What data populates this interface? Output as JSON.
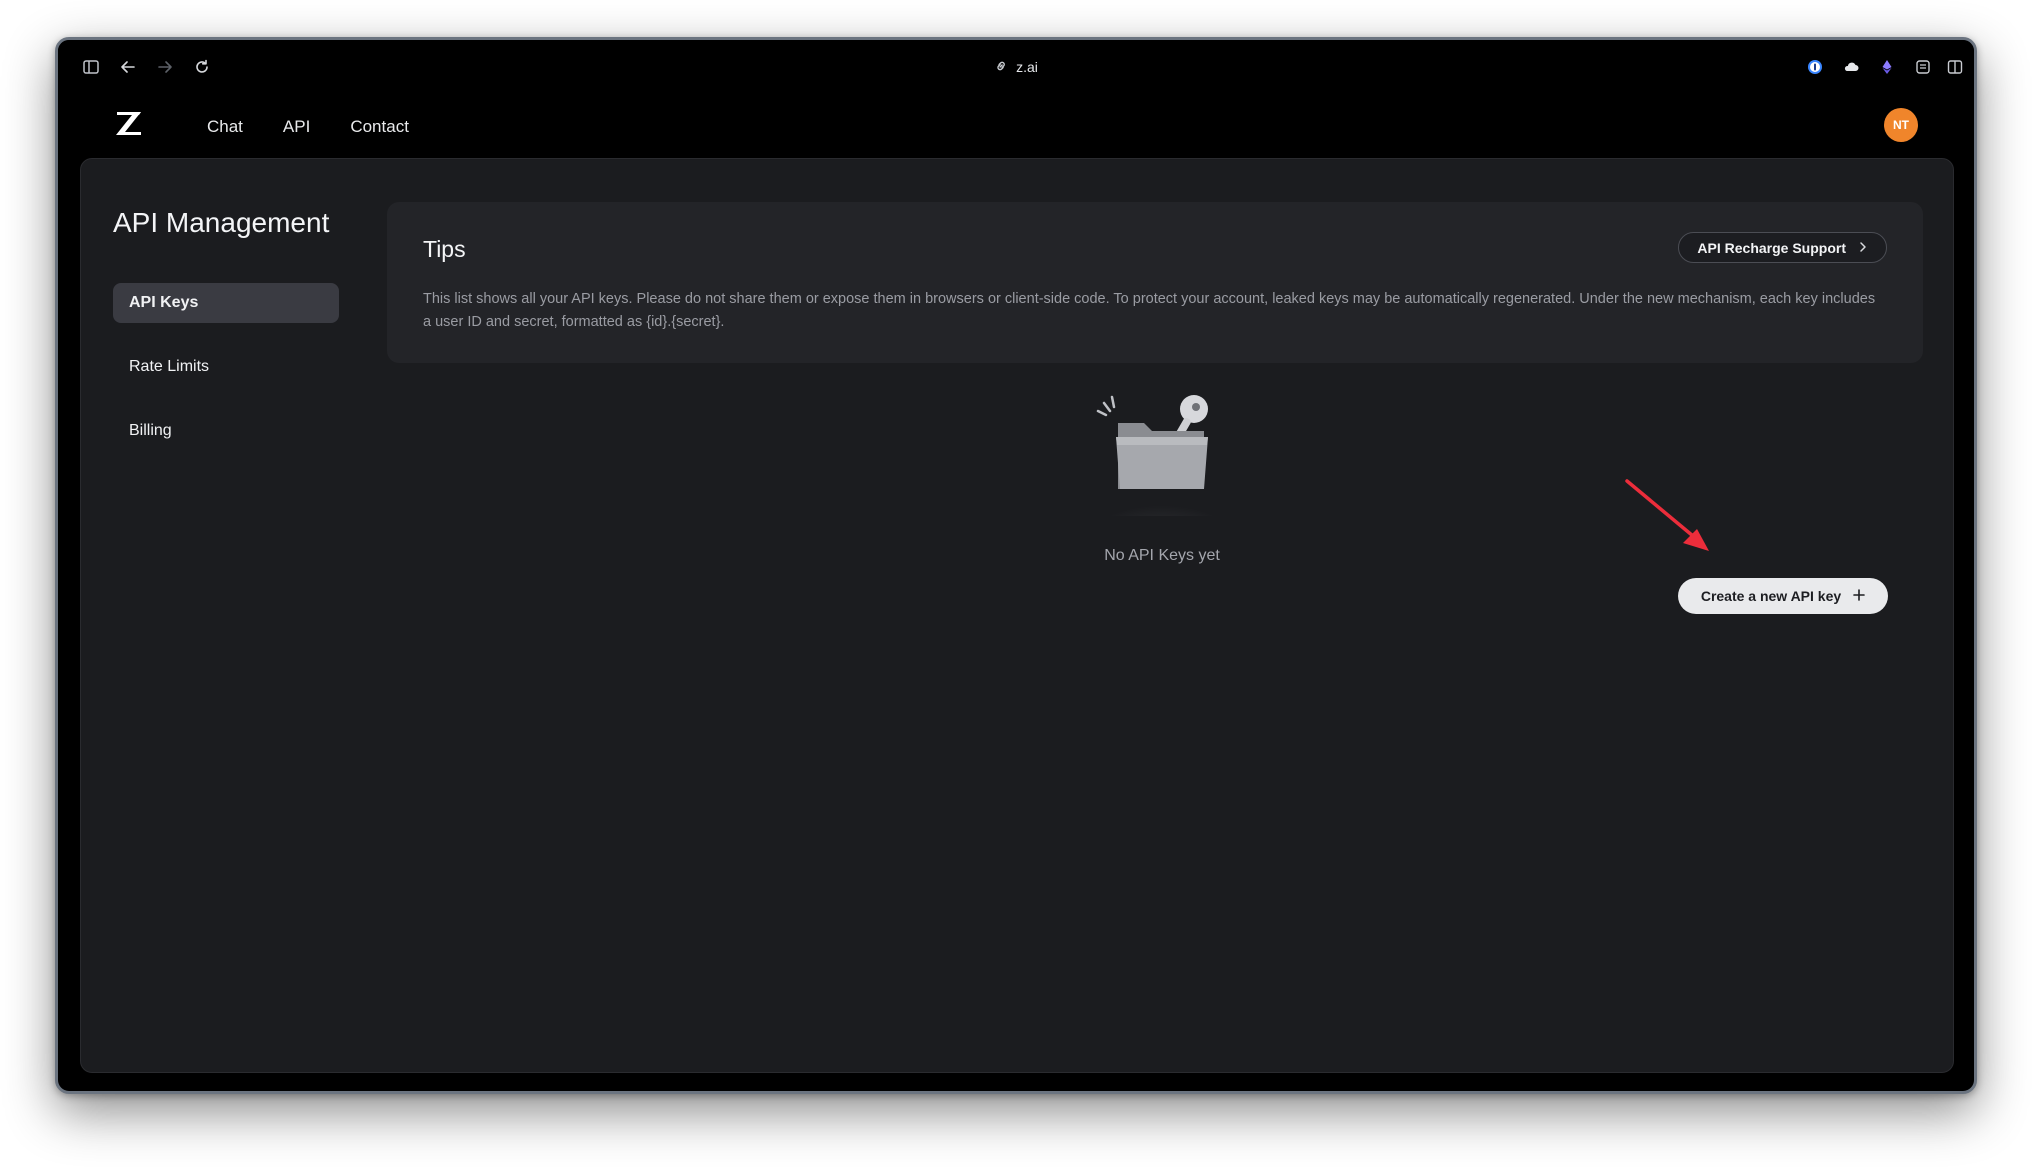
{
  "browser": {
    "url": "z.ai"
  },
  "header": {
    "nav": [
      "Chat",
      "API",
      "Contact"
    ],
    "avatar_initials": "NT"
  },
  "page": {
    "title": "API Management"
  },
  "sidebar": {
    "items": [
      {
        "label": "API Keys",
        "active": true
      },
      {
        "label": "Rate Limits",
        "active": false
      },
      {
        "label": "Billing",
        "active": false
      }
    ]
  },
  "tips": {
    "title": "Tips",
    "text": "This list shows all your API keys. Please do not share them or expose them in browsers or client-side code. To protect your account, leaked keys may be automatically regenerated. Under the new mechanism, each key includes a user ID and secret, formatted as {id}.{secret}.",
    "recharge_label": "API Recharge Support"
  },
  "empty_state": {
    "text": "No API Keys yet"
  },
  "actions": {
    "create_label": "Create a new API key"
  },
  "colors": {
    "accent_avatar": "#f0852b",
    "annotation_arrow": "#ec2d3b"
  }
}
